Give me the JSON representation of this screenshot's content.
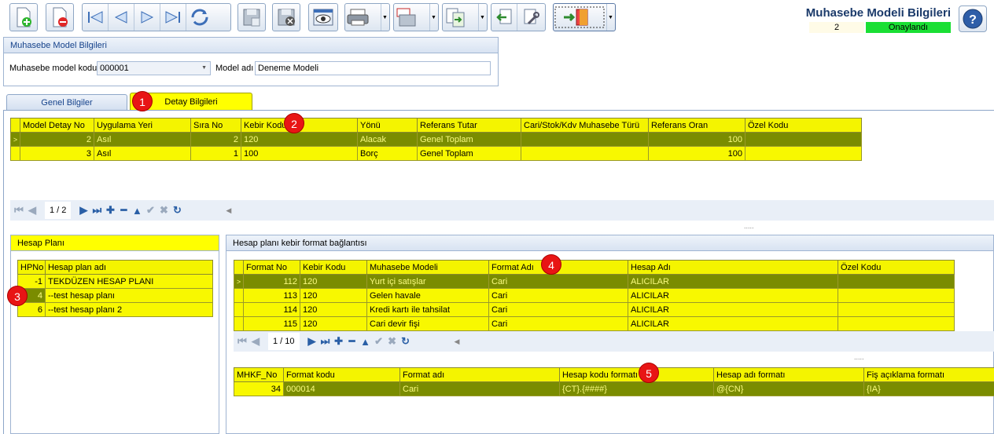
{
  "header": {
    "title": "Muhasebe Modeli Bilgileri",
    "count": "2",
    "status": "Onaylandı"
  },
  "model_group": {
    "title": "Muhasebe Model Bilgileri",
    "code_label": "Muhasebe model kodu",
    "code_value": "000001",
    "name_label": "Model adı",
    "name_value": "Deneme Modeli"
  },
  "tabs": {
    "general": "Genel Bilgiler",
    "detail": "Detay Bilgileri"
  },
  "detail_grid": {
    "headers": [
      "Model Detay No",
      "Uygulama Yeri",
      "Sıra No",
      "Kebir Kodu",
      "Yönü",
      "Referans Tutar",
      "Cari/Stok/Kdv Muhasebe Türü",
      "Referans Oran",
      "Özel Kodu"
    ],
    "rows": [
      [
        "2",
        "Asıl",
        "2",
        "120",
        "Alacak",
        "Genel Toplam",
        "",
        "100",
        ""
      ],
      [
        "3",
        "Asıl",
        "1",
        "100",
        "Borç",
        "Genel Toplam",
        "",
        "100",
        ""
      ]
    ],
    "page": "1 / 2"
  },
  "plan_group": {
    "title": "Hesap Planı",
    "headers": [
      "HPNo",
      "Hesap plan adı"
    ],
    "rows": [
      [
        "-1",
        "TEKDÜZEN HESAP PLANI"
      ],
      [
        "4",
        "--test hesap planı"
      ],
      [
        "6",
        "--test hesap planı 2"
      ]
    ]
  },
  "format_group": {
    "title": "Hesap planı kebir format bağlantısı",
    "headers": [
      "Format No",
      "Kebir Kodu",
      "Muhasebe Modeli",
      "Format Adı",
      "Hesap Adı",
      "Özel Kodu"
    ],
    "rows": [
      [
        "112",
        "120",
        "Yurt içi satışlar",
        "Cari",
        "ALICILAR",
        ""
      ],
      [
        "113",
        "120",
        "Gelen havale",
        "Cari",
        "ALICILAR",
        ""
      ],
      [
        "114",
        "120",
        "Kredi kartı ile tahsilat",
        "Cari",
        "ALICILAR",
        ""
      ],
      [
        "115",
        "120",
        "Cari devir fişi",
        "Cari",
        "ALICILAR",
        ""
      ]
    ],
    "page": "1 / 10"
  },
  "mhkf_grid": {
    "headers": [
      "MHKF_No",
      "Format kodu",
      "Format adı",
      "Hesap kodu formatı",
      "Hesap adı formatı",
      "Fiş açıklama formatı"
    ],
    "rows": [
      [
        "34",
        "000014",
        "Cari",
        "{CT}.{####}",
        "@{CN}",
        "{IA}"
      ]
    ]
  },
  "badges": [
    "1",
    "2",
    "3",
    "4",
    "5"
  ],
  "splitter": "....."
}
